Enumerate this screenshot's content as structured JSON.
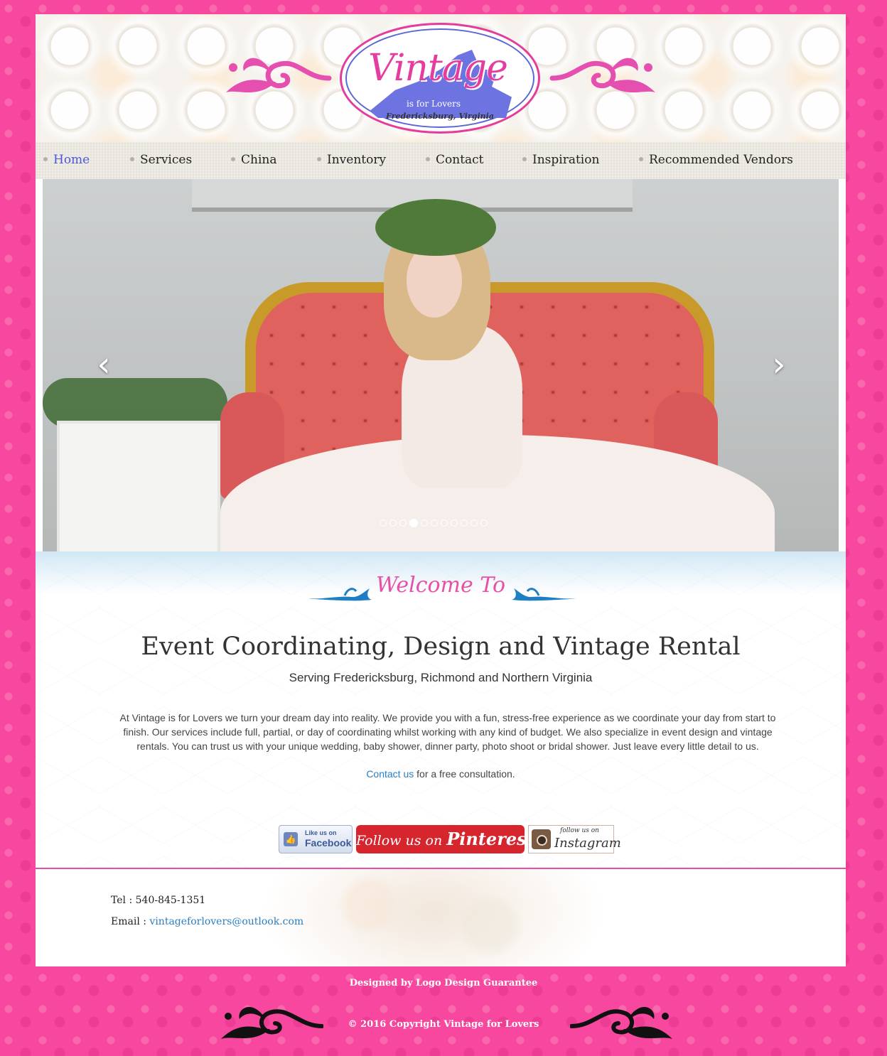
{
  "brand": {
    "logo_title": "Vintage",
    "logo_tagline": "is for Lovers",
    "logo_location": "Fredericksburg, Virginia"
  },
  "nav": {
    "items": [
      {
        "label": "Home",
        "active": true
      },
      {
        "label": "Services"
      },
      {
        "label": "China"
      },
      {
        "label": "Inventory"
      },
      {
        "label": "Contact"
      },
      {
        "label": "Inspiration"
      },
      {
        "label": "Recommended Vendors"
      }
    ]
  },
  "slider": {
    "prev_icon": "chevron-left-icon",
    "next_icon": "chevron-right-icon",
    "slide_count": 11,
    "active_slide": 4
  },
  "welcome": {
    "heading": "Welcome To",
    "title": "Event Coordinating, Design and Vintage Rental",
    "subtitle": "Serving Fredericksburg, Richmond and Northern Virginia",
    "intro": "At Vintage is for Lovers we turn your dream day into reality. We provide you with a fun, stress-free experience as we coordinate your day from start to finish. Our services include full, partial, or day of coordinating whilst working with any kind of budget. We also specialize in event design and vintage rentals. You can trust us with your unique wedding, baby shower, dinner party, photo shoot or bridal shower. Just leave every little detail to us.",
    "contact_link": "Contact us",
    "contact_suffix": " for a free consultation."
  },
  "social": {
    "facebook_small": "Like us on",
    "facebook_big": "Facebook",
    "pinterest_prefix": "Follow us on ",
    "pinterest_brand": "Pinterest",
    "instagram_small": "follow us on",
    "instagram_big": "Instagram"
  },
  "footer": {
    "tel_label": "Tel : ",
    "tel": "540-845-1351",
    "email_label": "Email : ",
    "email": "vintageforlovers@outlook.com",
    "credits": "Designed by Logo Design Guarantee",
    "copyright": "© 2016 Copyright Vintage for Lovers"
  },
  "colors": {
    "background_pink": "#f7479e",
    "nav_active": "#4f57d8",
    "link": "#2a7ec2",
    "welcome_pink": "#e94fa6",
    "pinterest_red": "#d7252e"
  }
}
